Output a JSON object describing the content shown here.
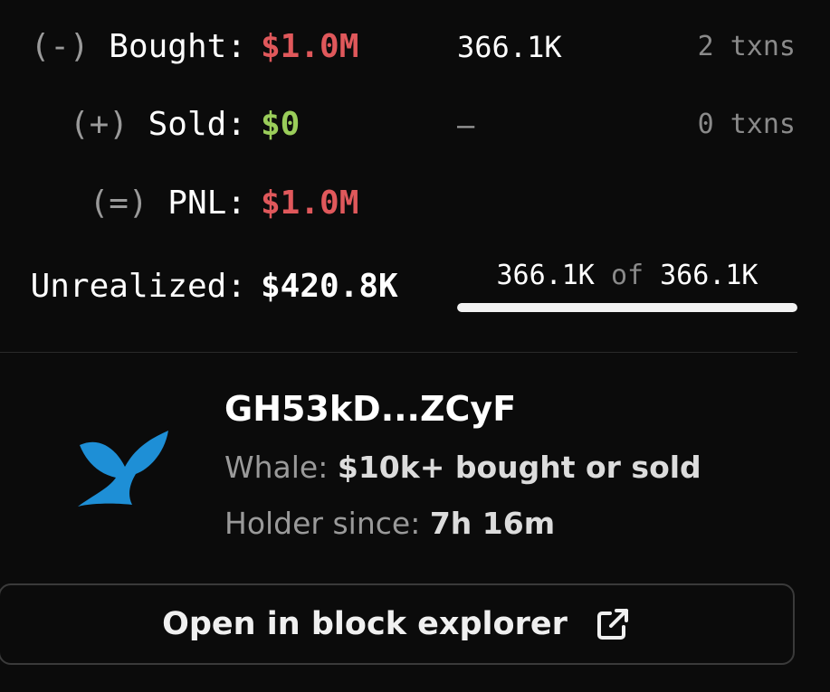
{
  "stats": {
    "bought": {
      "prefix": "(-)",
      "label": "Bought:",
      "amount": "$1.0M",
      "amount_color": "#e0585b",
      "quantity": "366.1K",
      "txns": "2 txns"
    },
    "sold": {
      "prefix": "(+)",
      "label": "Sold:",
      "amount": "$0",
      "amount_color": "#9acd5a",
      "quantity": "–",
      "txns": "0 txns"
    },
    "pnl": {
      "prefix": "(=)",
      "label": "PNL:",
      "amount": "$1.0M",
      "amount_color": "#e0585b"
    },
    "unrealized": {
      "label": "Unrealized:",
      "amount": "$420.8K",
      "amount_color": "#ffffff",
      "held": "366.1K",
      "of_label": "of",
      "total": "366.1K",
      "held_fraction": 1.0
    }
  },
  "holder": {
    "icon": "whale-tail-icon",
    "icon_color": "#1e8fd6",
    "address": "GH53kD...ZCyF",
    "whale_label": "Whale:",
    "whale_value": "$10k+ bought or sold",
    "since_label": "Holder since:",
    "since_value": "7h 16m"
  },
  "actions": {
    "explorer_label": "Open in block explorer",
    "explorer_icon": "external-link-icon"
  }
}
